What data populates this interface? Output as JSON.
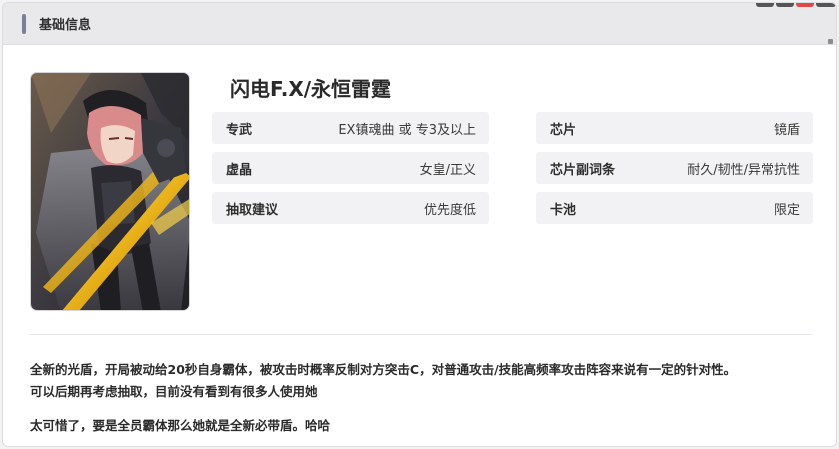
{
  "header": {
    "title": "基础信息"
  },
  "character": {
    "name": "闪电F.X/永恒雷霆",
    "portrait_alt": "character-portrait"
  },
  "info": [
    {
      "key": "专武",
      "value": "EX镇魂曲 或 专3及以上"
    },
    {
      "key": "芯片",
      "value": "镜盾"
    },
    {
      "key": "虚晶",
      "value": "女皇/正义"
    },
    {
      "key": "芯片副词条",
      "value": "耐久/韧性/异常抗性"
    },
    {
      "key": "抽取建议",
      "value": "优先度低"
    },
    {
      "key": "卡池",
      "value": "限定"
    }
  ],
  "description": {
    "line1": "全新的光盾，开局被动给20秒自身霸体，被攻击时概率反制对方突击C，对普通攻击/技能高频率攻击阵容来说有一定的针对性。",
    "line2": "可以后期再考虑抽取，目前没有看到有很多人使用她",
    "line3": "太可惜了，要是全员霸体那么她就是全新必带盾。哈哈"
  },
  "colors": {
    "accent_bar": "#7a7f9c",
    "cell_bg": "#f2f2f4",
    "header_bg": "#e9e9ec"
  }
}
